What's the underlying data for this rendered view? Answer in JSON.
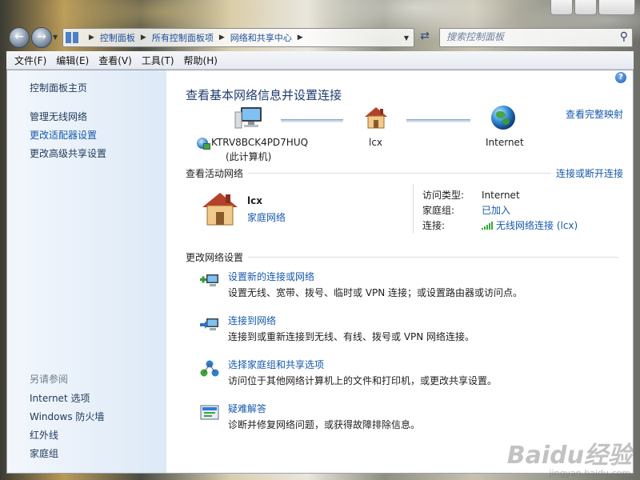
{
  "address_bar": {
    "breadcrumbs": [
      "控制面板",
      "所有控制面板项",
      "网络和共享中心"
    ],
    "search_placeholder": "搜索控制面板"
  },
  "menu": [
    "文件(F)",
    "编辑(E)",
    "查看(V)",
    "工具(T)",
    "帮助(H)"
  ],
  "sidebar": {
    "items": [
      "控制面板主页",
      "管理无线网络",
      "更改适配器设置",
      "更改高级共享设置"
    ],
    "see_also_title": "另请参阅",
    "see_also": [
      "Internet 选项",
      "Windows 防火墙",
      "红外线",
      "家庭组"
    ]
  },
  "main": {
    "title": "查看基本网络信息并设置连接",
    "full_map_link": "查看完整映射",
    "map": {
      "computer_name": "KTRV8BCK4PD7HUQ",
      "computer_sub": "(此计算机)",
      "network": "lcx",
      "internet": "Internet"
    },
    "active_section": "查看活动网络",
    "connect_link": "连接或断开连接",
    "active_network": {
      "name": "lcx",
      "type": "家庭网络",
      "access_type_label": "访问类型:",
      "access_type_value": "Internet",
      "homegroup_label": "家庭组:",
      "homegroup_value": "已加入",
      "connection_label": "连接:",
      "connection_value": "无线网络连接 (lcx)"
    },
    "change_section": "更改网络设置",
    "tasks": [
      {
        "title": "设置新的连接或网络",
        "desc": "设置无线、宽带、拨号、临时或 VPN 连接；或设置路由器或访问点。"
      },
      {
        "title": "连接到网络",
        "desc": "连接到或重新连接到无线、有线、拨号或 VPN 网络连接。"
      },
      {
        "title": "选择家庭组和共享选项",
        "desc": "访问位于其他网络计算机上的文件和打印机，或更改共享设置。"
      },
      {
        "title": "疑难解答",
        "desc": "诊断并修复网络问题，或获得故障排除信息。"
      }
    ]
  },
  "watermark": {
    "text": "Baidu经验",
    "sub": "jingyan.baidu.com"
  }
}
